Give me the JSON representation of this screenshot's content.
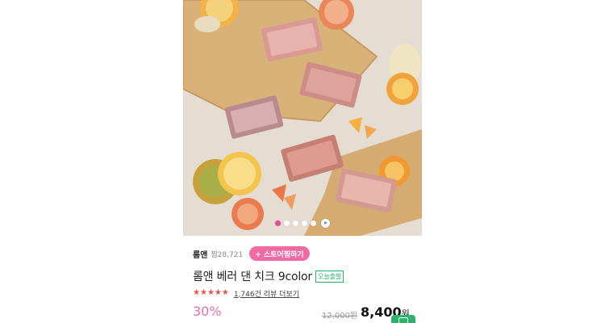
{
  "carousel": {
    "slide_count": 5,
    "active_index": 0
  },
  "store": {
    "name": "롬앤",
    "wish_count": "찜28,721",
    "follow_label": "+ 스토어찜하기"
  },
  "product": {
    "title": "롬앤 베러 댄 치크 9color",
    "ship_badge": "오늘출발",
    "rating_stars": 4.5,
    "review_text": "1,746건 리뷰 더보기"
  },
  "price": {
    "discount": "30%",
    "original": "12,000원",
    "sale_value": "8,400",
    "sale_unit": "원"
  },
  "colors": {
    "accent_pink": "#f06ba2",
    "discount_pink": "#e86fae",
    "badge_green": "#2bb36b",
    "star_red": "#e8504c"
  },
  "icons": [
    "star-icon",
    "play-icon",
    "chat-icon"
  ]
}
